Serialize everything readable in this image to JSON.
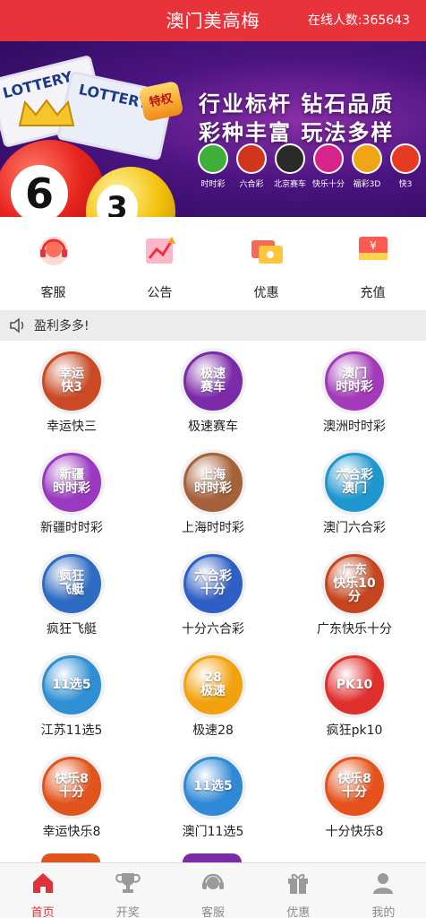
{
  "header": {
    "title": "澳门美高梅",
    "online_text": "在线人数:365643"
  },
  "banner": {
    "card_text": "LOTTERY",
    "tag_text": "特权",
    "ball_red_num": "6",
    "ball_yellow_num": "3",
    "slogan_line1": "行业标杆 钻石品质",
    "slogan_line2": "彩种丰富 玩法多样",
    "lotteries": [
      {
        "name": "时时彩",
        "color": "#3fae3a"
      },
      {
        "name": "六合彩",
        "color": "#d2351e"
      },
      {
        "name": "北京赛车",
        "color": "#2a2a2a"
      },
      {
        "name": "快乐十分",
        "color": "#d8238a"
      },
      {
        "name": "福彩3D",
        "color": "#f0a614"
      },
      {
        "name": "快3",
        "color": "#e63a25"
      }
    ]
  },
  "quick": [
    {
      "label": "客服",
      "icon": "headset-icon"
    },
    {
      "label": "公告",
      "icon": "chart-icon"
    },
    {
      "label": "优惠",
      "icon": "coupon-icon"
    },
    {
      "label": "充值",
      "icon": "recharge-icon"
    }
  ],
  "notice": {
    "text": "盈利多多!"
  },
  "games": [
    {
      "label": "幸运快三",
      "badge": "幸运\n快3",
      "color": "#c94a25"
    },
    {
      "label": "极速赛车",
      "badge": "极速\n赛车",
      "color": "#7b2aa8"
    },
    {
      "label": "澳洲时时彩",
      "badge": "澳门\n时时彩",
      "color": "#a23ab9"
    },
    {
      "label": "新疆时时彩",
      "badge": "新疆\n时时彩",
      "color": "#9a39c0"
    },
    {
      "label": "上海时时彩",
      "badge": "上海\n时时彩",
      "color": "#a4613a"
    },
    {
      "label": "澳门六合彩",
      "badge": "六合彩\n澳门",
      "color": "#1e97cf"
    },
    {
      "label": "疯狂飞艇",
      "badge": "疯狂\n飞艇",
      "color": "#2e6bc2"
    },
    {
      "label": "十分六合彩",
      "badge": "六合彩\n十分",
      "color": "#2f5ec4"
    },
    {
      "label": "广东快乐十分",
      "badge": "广东\n快乐10分",
      "color": "#c5461e"
    },
    {
      "label": "江苏11选5",
      "badge": "11选5",
      "color": "#2e8fd2"
    },
    {
      "label": "极速28",
      "badge": "28\n极速",
      "color": "#f2a20e"
    },
    {
      "label": "疯狂pk10",
      "badge": "PK10",
      "color": "#e0302e"
    },
    {
      "label": "幸运快乐8",
      "badge": "快乐8\n十分",
      "color": "#e2541d"
    },
    {
      "label": "澳门11选5",
      "badge": "11选5",
      "color": "#2f89d6"
    },
    {
      "label": "十分快乐8",
      "badge": "快乐8\n十分",
      "color": "#e5521b"
    }
  ],
  "tabs": [
    {
      "label": "首页",
      "icon": "home-icon",
      "active": true
    },
    {
      "label": "开奖",
      "icon": "trophy-icon",
      "active": false
    },
    {
      "label": "客服",
      "icon": "headset-icon",
      "active": false
    },
    {
      "label": "优惠",
      "icon": "gift-icon",
      "active": false
    },
    {
      "label": "我的",
      "icon": "user-icon",
      "active": false
    }
  ],
  "colors": {
    "brand": "#e8333a",
    "active_tab": "#e0323a"
  }
}
